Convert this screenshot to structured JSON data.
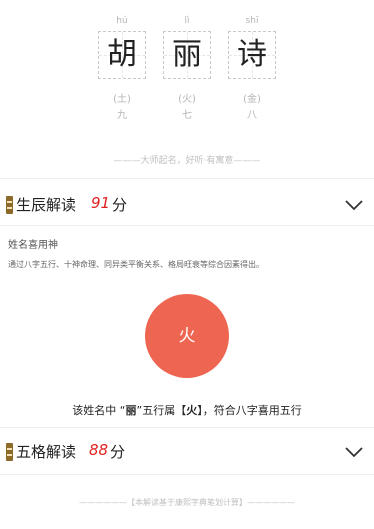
{
  "name": {
    "chars": [
      {
        "pinyin": "hú",
        "char": "胡",
        "element": "(土)",
        "strokes": "九"
      },
      {
        "pinyin": "lì",
        "char": "丽",
        "element": "(火)",
        "strokes": "七"
      },
      {
        "pinyin": "shī",
        "char": "诗",
        "element": "(金)",
        "strokes": "八"
      }
    ]
  },
  "motto": "———大师起名，好听·有寓意———",
  "sections": {
    "shengchen": {
      "title": "生辰解读",
      "score": "91",
      "unit": "分",
      "pref_label": "姓名喜用神",
      "pref_desc": "通过八字五行、十神命理、同异类平衡关系、格局旺衰等综合因素得出。",
      "element_circle": "火",
      "result_prefix": "该姓名中 “",
      "result_char": "丽",
      "result_mid": "”五行属【",
      "result_element": "火",
      "result_suffix": "】，符合八字喜用五行"
    },
    "wuge": {
      "title": "五格解读",
      "score": "88",
      "unit": "分"
    }
  },
  "footer": "——————【本解读基于康熙字典笔划计算】——————",
  "colors": {
    "accent_red": "#e02020",
    "fire_circle": "#ee6651"
  },
  "icons": {
    "section_seal": "seal-icon",
    "expand": "chevron-down-icon"
  }
}
